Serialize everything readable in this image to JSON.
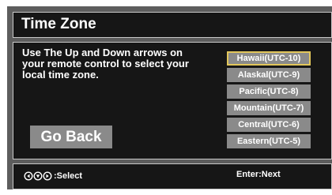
{
  "title": "Time Zone",
  "instructions": "Use The Up and Down arrows on your remote control to select your local time zone.",
  "go_back_label": "Go Back",
  "zones": [
    {
      "label": "Hawaii(UTC-10)",
      "selected": true
    },
    {
      "label": "Alaskal(UTC-9)",
      "selected": false
    },
    {
      "label": "Pacific(UTC-8)",
      "selected": false
    },
    {
      "label": "Mountain(UTC-7)",
      "selected": false
    },
    {
      "label": "Central(UTC-6)",
      "selected": false
    },
    {
      "label": "Eastern(UTC-5)",
      "selected": false
    }
  ],
  "footer": {
    "select_icon": "navigation-arrows-icon",
    "select_label": ":Select",
    "next_label": "Enter:Next"
  },
  "colors": {
    "panel": "#161616",
    "frame": "#5d5d5d",
    "button": "#8a8a8a",
    "highlight": "#e2c65a"
  }
}
